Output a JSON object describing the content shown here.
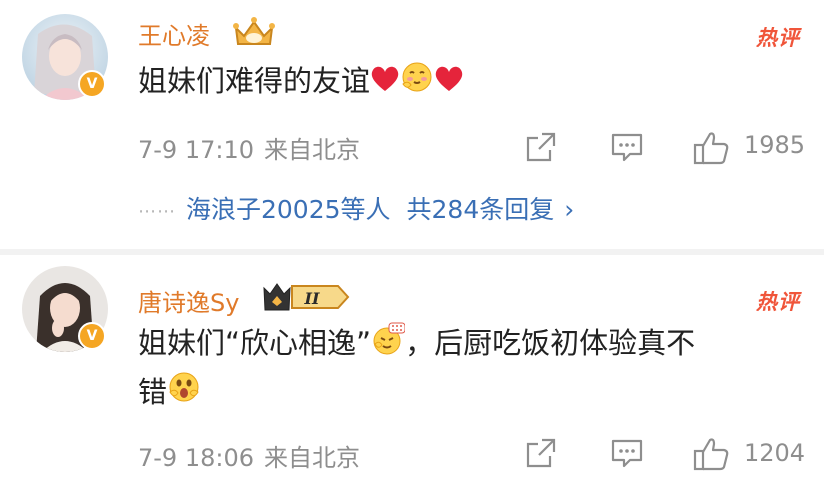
{
  "comments": [
    {
      "username": "王心凌",
      "hot_label": "热评",
      "text": "姐妹们难得的友谊",
      "time": "7-9 17:10",
      "source": "来自北京",
      "likes": "1985",
      "replies": {
        "dots": "⋯⋯",
        "who": "海浪子20025等人",
        "total": "共284条回复",
        "chevron": "›"
      }
    },
    {
      "username": "唐诗逸Sy",
      "hot_label": "热评",
      "text_line1": "姐妹们“欣心相逸”",
      "text_line1b": "，后厨吃饭初体验真不",
      "text_line2": "错",
      "time": "7-9 18:06",
      "source": "来自北京",
      "likes": "1204",
      "rank_badge": "II"
    }
  ],
  "colors": {
    "username": "#e07a2a",
    "hot": "#f0553a",
    "link": "#3a6fb5",
    "meta": "#8e8e8e",
    "verified": "#f5a623"
  },
  "icons": {
    "verified": "V"
  }
}
